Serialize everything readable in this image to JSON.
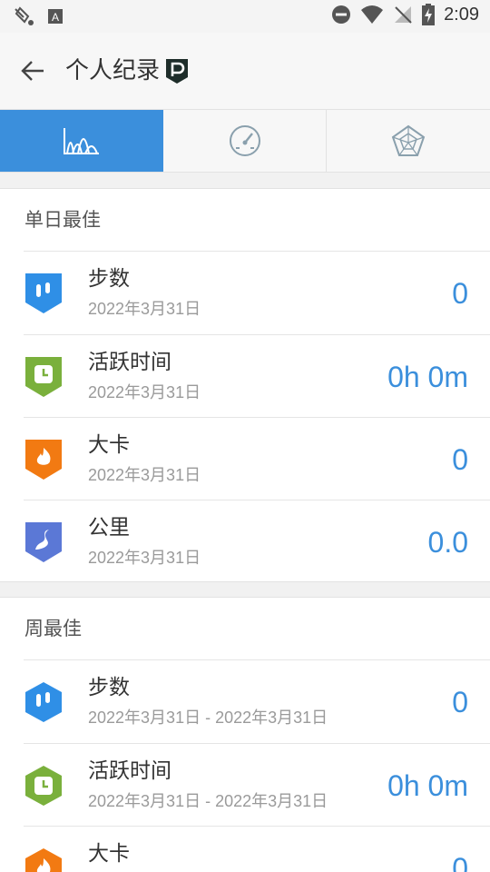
{
  "status_bar": {
    "time": "2:09",
    "icons": [
      "paint-icon",
      "keyboard-a-icon",
      "do-not-disturb-icon",
      "wifi-icon",
      "no-signal-icon",
      "battery-charging-icon"
    ]
  },
  "header": {
    "title": "个人纪录",
    "back_icon": "back-arrow-icon",
    "badge_icon": "p-badge-icon"
  },
  "tabs": [
    {
      "icon": "distribution-chart-icon",
      "active": true
    },
    {
      "icon": "speedometer-icon",
      "active": false
    },
    {
      "icon": "radar-chart-icon",
      "active": false
    }
  ],
  "accent_color": "#3b8fdc",
  "sections": [
    {
      "title": "单日最佳",
      "items": [
        {
          "name": "步数",
          "date": "2022年3月31日",
          "value": "0",
          "icon": "steps-icon",
          "color": "#2f8fe6"
        },
        {
          "name": "活跃时间",
          "date": "2022年3月31日",
          "value": "0h 0m",
          "icon": "clock-icon",
          "color": "#7ab03c"
        },
        {
          "name": "大卡",
          "date": "2022年3月31日",
          "value": "0",
          "icon": "flame-icon",
          "color": "#f27a12"
        },
        {
          "name": "公里",
          "date": "2022年3月31日",
          "value": "0.0",
          "icon": "route-icon",
          "color": "#5b78d6"
        }
      ]
    },
    {
      "title": "周最佳",
      "items": [
        {
          "name": "步数",
          "date": "2022年3月31日 - 2022年3月31日",
          "value": "0",
          "icon": "steps-icon",
          "color": "#2f8fe6"
        },
        {
          "name": "活跃时间",
          "date": "2022年3月31日 - 2022年3月31日",
          "value": "0h 0m",
          "icon": "clock-icon",
          "color": "#7ab03c"
        },
        {
          "name": "大卡",
          "date": "",
          "value": "0",
          "icon": "flame-icon",
          "color": "#f27a12"
        }
      ]
    }
  ]
}
